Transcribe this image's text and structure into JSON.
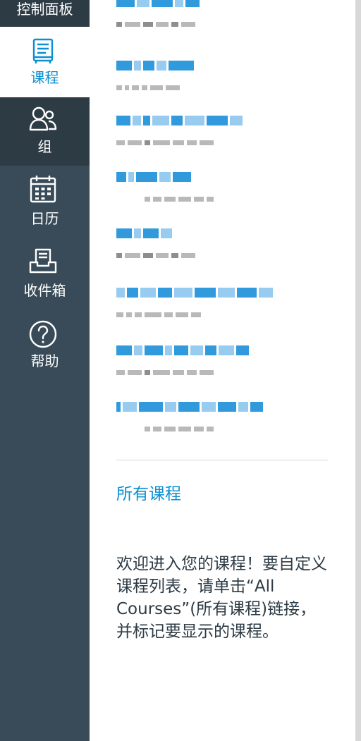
{
  "nav": {
    "dashboard_label": "控制面板",
    "items": [
      {
        "label": "课程",
        "icon": "book-icon",
        "active": true
      },
      {
        "label": "组",
        "icon": "users-icon",
        "active": false
      },
      {
        "label": "日历",
        "icon": "calendar-icon",
        "active": false
      },
      {
        "label": "收件箱",
        "icon": "inbox-icon",
        "active": false
      },
      {
        "label": "帮助",
        "icon": "help-icon",
        "active": false
      }
    ],
    "colors": {
      "background": "#394b58",
      "highlight": "#2d3b45",
      "accent": "#0b8fd1"
    }
  },
  "tray": {
    "courses_redacted": 8,
    "all_courses_link": "所有课程",
    "help_text": "欢迎进入您的课程！要自定义课程列表，请单击“All Courses”(所有课程)链接，并标记要显示的课程。"
  }
}
